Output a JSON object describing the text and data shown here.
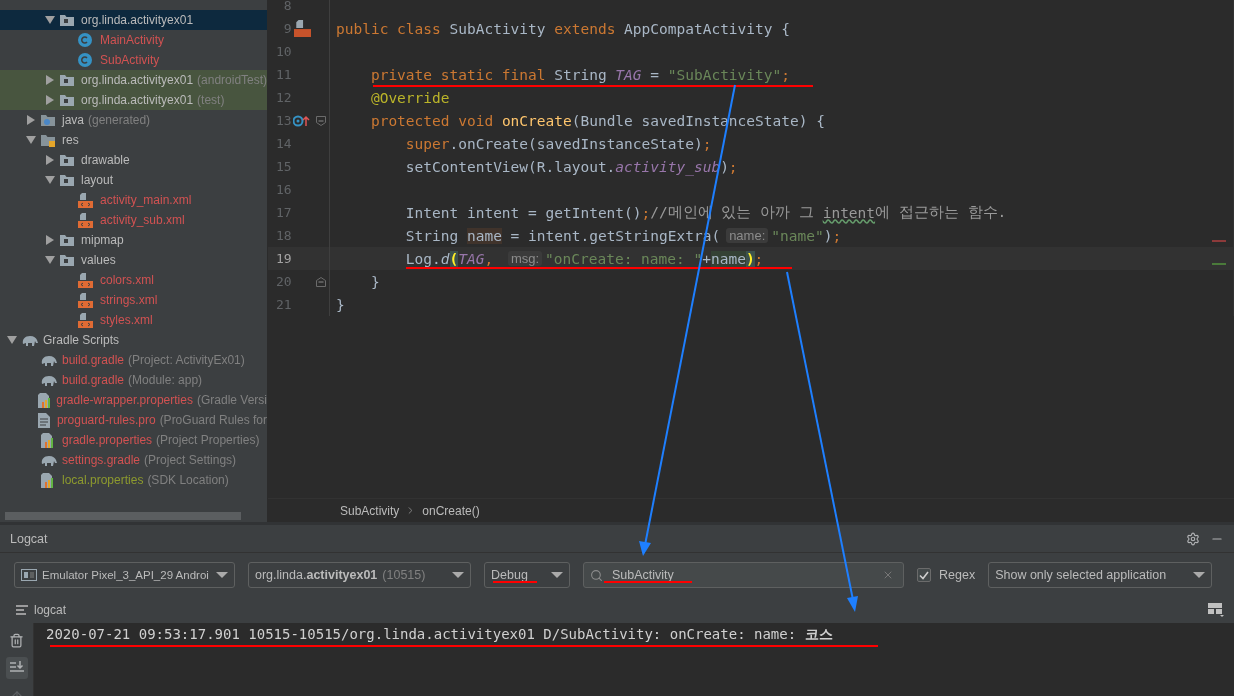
{
  "project_tree": {
    "java_children": [
      {
        "label": "org.linda.activityex01",
        "kind": "package",
        "expanded": true,
        "selected": true,
        "color": "#bbbbbb",
        "children": [
          {
            "label": "MainActivity",
            "kind": "class",
            "selected": false,
            "color": "#d25252"
          },
          {
            "label": "SubActivity",
            "kind": "class",
            "selected": false,
            "color": "#d25252"
          }
        ]
      },
      {
        "label": "org.linda.activityex01",
        "note": "(androidTest)",
        "kind": "package",
        "expanded": false,
        "selected": false,
        "test_source": true,
        "color": "#bbbbbb"
      },
      {
        "label": "org.linda.activityex01",
        "note": "(test)",
        "kind": "package",
        "expanded": false,
        "selected": false,
        "test_source": true,
        "color": "#bbbbbb"
      }
    ],
    "app_children": [
      {
        "label": "java",
        "note": "(generated)",
        "kind": "generated-folder",
        "expanded": false,
        "selected": false,
        "color": "#bbbbbb"
      },
      {
        "label": "res",
        "kind": "resource-folder",
        "expanded": true,
        "selected": false,
        "color": "#bbbbbb",
        "children": [
          {
            "label": "drawable",
            "kind": "package",
            "expanded": false,
            "selected": false,
            "color": "#bbbbbb"
          },
          {
            "label": "layout",
            "kind": "package",
            "expanded": true,
            "selected": false,
            "color": "#bbbbbb",
            "children": [
              {
                "label": "activity_main.xml",
                "kind": "xml",
                "selected": false,
                "color": "#d25252"
              },
              {
                "label": "activity_sub.xml",
                "kind": "xml",
                "selected": false,
                "color": "#d25252"
              }
            ]
          },
          {
            "label": "mipmap",
            "kind": "package",
            "expanded": false,
            "selected": false,
            "color": "#bbbbbb"
          },
          {
            "label": "values",
            "kind": "package",
            "expanded": true,
            "selected": false,
            "color": "#bbbbbb",
            "children": [
              {
                "label": "colors.xml",
                "kind": "xml",
                "selected": false,
                "color": "#d25252"
              },
              {
                "label": "strings.xml",
                "kind": "xml",
                "selected": false,
                "color": "#d25252"
              },
              {
                "label": "styles.xml",
                "kind": "xml",
                "selected": false,
                "color": "#d25252"
              }
            ]
          }
        ]
      }
    ],
    "gradle_scripts": {
      "label": "Gradle Scripts",
      "kind": "gradle",
      "expanded": true,
      "selected": false,
      "color": "#bbbbbb",
      "children": [
        {
          "label": "build.gradle",
          "note": "(Project: ActivityEx01)",
          "kind": "gradle",
          "selected": false,
          "color": "#d25252"
        },
        {
          "label": "build.gradle",
          "note": "(Module: app)",
          "kind": "gradle",
          "selected": false,
          "color": "#d25252"
        },
        {
          "label": "gradle-wrapper.properties",
          "note": "(Gradle Versi",
          "kind": "properties",
          "selected": false,
          "color": "#d25252"
        },
        {
          "label": "proguard-rules.pro",
          "note": "(ProGuard Rules for",
          "kind": "text",
          "selected": false,
          "color": "#d25252"
        },
        {
          "label": "gradle.properties",
          "note": "(Project Properties)",
          "kind": "properties",
          "selected": false,
          "color": "#d25252"
        },
        {
          "label": "settings.gradle",
          "note": "(Project Settings)",
          "kind": "gradle",
          "selected": false,
          "color": "#d25252"
        },
        {
          "label": "local.properties",
          "note": "(SDK Location)",
          "kind": "properties",
          "selected": false,
          "color": "#8d9a2e"
        }
      ]
    }
  },
  "editor": {
    "lines": [
      {
        "number": "8",
        "current": false
      },
      {
        "number": "9",
        "current": false,
        "gutter": {
          "kind": "layout"
        },
        "tokens": [
          {
            "kind": "kw",
            "text": "public class "
          },
          {
            "kind": "plain",
            "text": "SubActivity "
          },
          {
            "kind": "kw",
            "text": "extends "
          },
          {
            "kind": "plain",
            "text": "AppCompatActivity {"
          }
        ]
      },
      {
        "number": "10",
        "current": false
      },
      {
        "number": "11",
        "current": false,
        "tokens": [
          {
            "kind": "kw",
            "text": "    private static final "
          },
          {
            "kind": "plain",
            "text": "String "
          },
          {
            "kind": "field",
            "text": "TAG"
          },
          {
            "kind": "plain",
            "text": " = "
          },
          {
            "kind": "str",
            "text": "\"SubActivity\""
          },
          {
            "kind": "kw",
            "text": ";"
          }
        ]
      },
      {
        "number": "12",
        "current": false,
        "tokens": [
          {
            "kind": "annotation",
            "text": "    @Override"
          }
        ]
      },
      {
        "number": "13",
        "current": false,
        "gutter": {
          "kind": "override"
        },
        "fold": {
          "kind": "open"
        },
        "tokens": [
          {
            "kind": "kw",
            "text": "    protected void "
          },
          {
            "kind": "method",
            "text": "onCreate"
          },
          {
            "kind": "plain",
            "text": "(Bundle savedInstanceState) {"
          }
        ]
      },
      {
        "number": "14",
        "current": false,
        "tokens": [
          {
            "kind": "kw",
            "text": "        super"
          },
          {
            "kind": "plain",
            "text": ".onCreate(savedInstanceState)"
          },
          {
            "kind": "kw",
            "text": ";"
          }
        ]
      },
      {
        "number": "15",
        "current": false,
        "tokens": [
          {
            "kind": "plain",
            "text": "        setContentView(R.layout."
          },
          {
            "kind": "field",
            "text": "activity_sub"
          },
          {
            "kind": "plain",
            "text": ")"
          },
          {
            "kind": "kw",
            "text": ";"
          }
        ]
      },
      {
        "number": "16",
        "current": false
      },
      {
        "number": "17",
        "current": false,
        "tokens": [
          {
            "kind": "plain",
            "text": "        Intent intent = getIntent()"
          },
          {
            "kind": "kw",
            "text": ";"
          },
          {
            "kind": "comment",
            "text": "//메인에 있는 아까 그 "
          },
          {
            "kind": "typo",
            "text": "intent"
          },
          {
            "kind": "comment",
            "text": "에 접근하는 함수."
          }
        ]
      },
      {
        "number": "18",
        "current": false,
        "tokens": [
          {
            "kind": "plain",
            "text": "        String "
          },
          {
            "kind": "usage",
            "text": "name"
          },
          {
            "kind": "plain",
            "text": " = intent.getStringExtra("
          },
          {
            "kind": "hint",
            "text": "name:"
          },
          {
            "kind": "str",
            "text": "\"name\""
          },
          {
            "kind": "plain",
            "text": ")"
          },
          {
            "kind": "kw",
            "text": ";"
          }
        ]
      },
      {
        "number": "19",
        "current": true,
        "tokens": [
          {
            "kind": "plain",
            "text": "        Log."
          },
          {
            "kind": "static",
            "text": "d"
          },
          {
            "kind": "brace",
            "text": "("
          },
          {
            "kind": "field",
            "text": "TAG"
          },
          {
            "kind": "kw",
            "text": ", "
          },
          {
            "kind": "hint",
            "text": "msg:"
          },
          {
            "kind": "str",
            "text": "\"onCreate: name: \""
          },
          {
            "kind": "plain",
            "text": "+"
          },
          {
            "kind": "write",
            "text": "name"
          },
          {
            "kind": "brace",
            "text": ")"
          },
          {
            "kind": "kw",
            "text": ";"
          }
        ]
      },
      {
        "number": "20",
        "current": false,
        "fold": {
          "kind": "close"
        },
        "tokens": [
          {
            "kind": "plain",
            "text": "    }"
          }
        ]
      },
      {
        "number": "21",
        "current": false,
        "tokens": [
          {
            "kind": "plain",
            "text": "}"
          }
        ]
      }
    ],
    "breadcrumbs": [
      "SubActivity",
      "onCreate()"
    ]
  },
  "logcat": {
    "title": "Logcat",
    "device": "Emulator Pixel_3_API_29 Androi",
    "process": {
      "name": "org.linda.**activityex01**",
      "pid": "(10515)"
    },
    "level": "Debug",
    "search": {
      "value": "SubActivity"
    },
    "regex": {
      "label": "Regex",
      "checked": true
    },
    "filter": "Show only selected application",
    "tab": "logcat",
    "log_lines": [
      "2020-07-21 09:53:17.901 10515-10515/org.linda.activityex01 D/SubActivity: onCreate: name: **코스**"
    ]
  }
}
